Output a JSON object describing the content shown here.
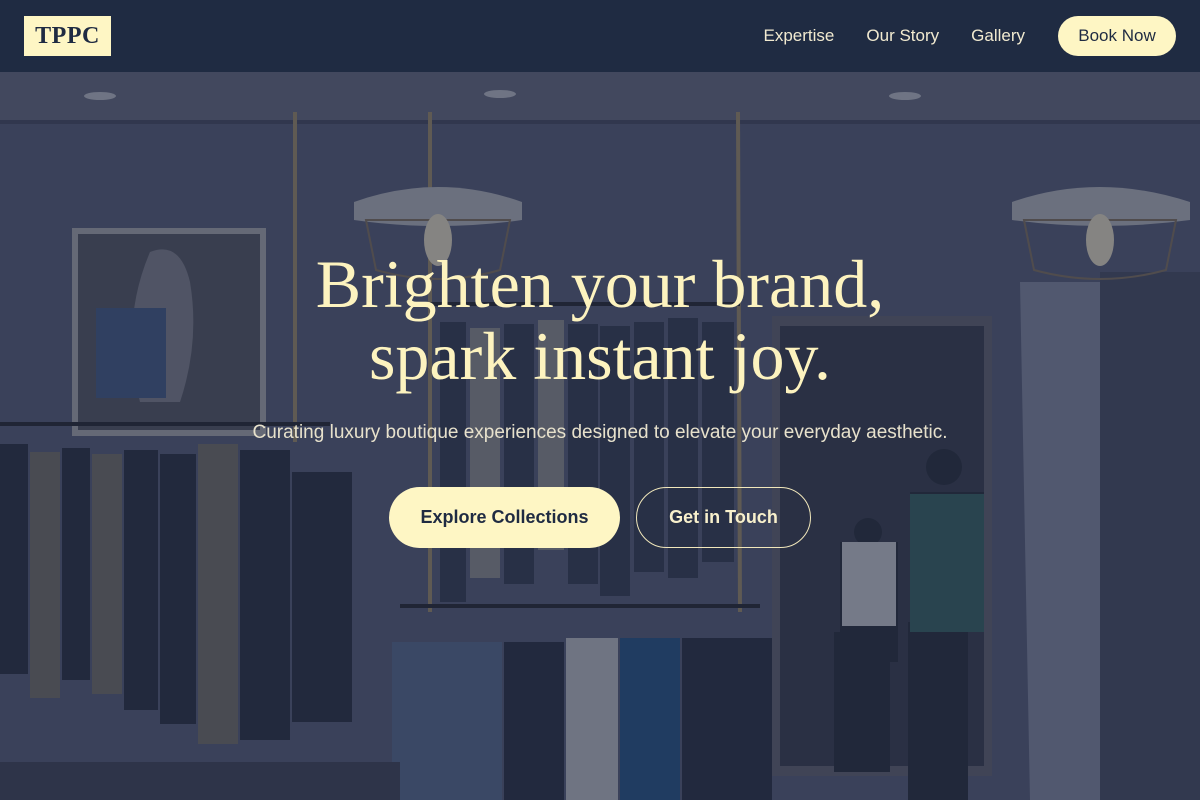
{
  "nav": {
    "logo": "TPPC",
    "links": [
      "Expertise",
      "Our Story",
      "Gallery"
    ],
    "book_label": "Book Now"
  },
  "hero": {
    "headline_line1": "Brighten your brand,",
    "headline_line2": "spark instant joy.",
    "subline": "Curating luxury boutique experiences designed to elevate your everyday aesthetic.",
    "cta_primary": "Explore Collections",
    "cta_secondary": "Get in Touch",
    "background_image": "boutique-clothing-store-photo"
  },
  "colors": {
    "nav_bg": "#1f2b42",
    "accent": "#fef6c4",
    "headline": "#fdf3bf"
  }
}
